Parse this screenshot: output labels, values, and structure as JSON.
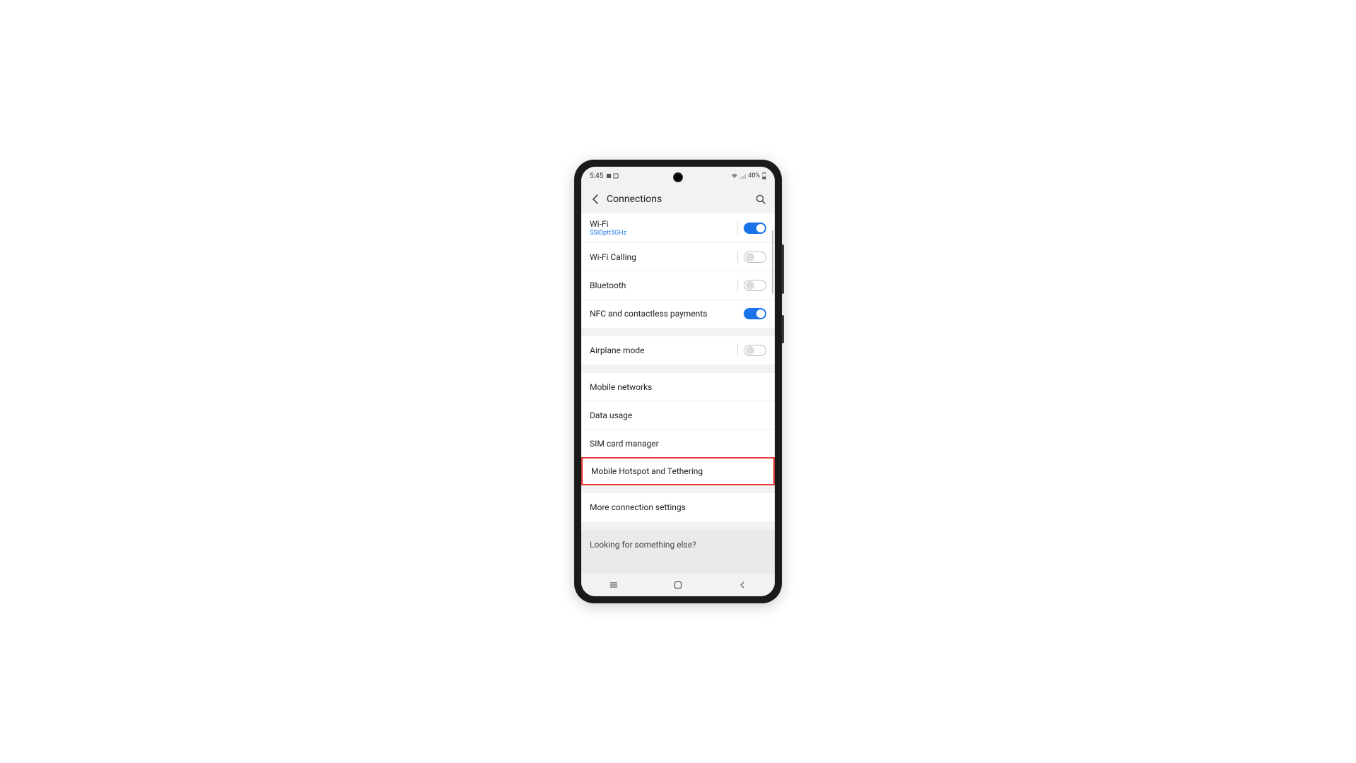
{
  "status_bar": {
    "time": "5:45",
    "battery_text": "40%"
  },
  "header": {
    "title": "Connections"
  },
  "groups": [
    {
      "rows": [
        {
          "title": "Wi-Fi",
          "subtitle": "SSIDptt5GHz",
          "toggle": "on"
        },
        {
          "title": "Wi-Fi Calling",
          "toggle": "off"
        },
        {
          "title": "Bluetooth",
          "toggle": "off"
        },
        {
          "title": "NFC and contactless payments",
          "toggle": "on"
        }
      ]
    },
    {
      "rows": [
        {
          "title": "Airplane mode",
          "toggle": "off"
        }
      ]
    },
    {
      "rows": [
        {
          "title": "Mobile networks"
        },
        {
          "title": "Data usage"
        },
        {
          "title": "SIM card manager"
        },
        {
          "title": "Mobile Hotspot and Tethering",
          "highlighted": true
        }
      ]
    },
    {
      "rows": [
        {
          "title": "More connection settings"
        }
      ]
    }
  ],
  "footer_hint": "Looking for something else?"
}
